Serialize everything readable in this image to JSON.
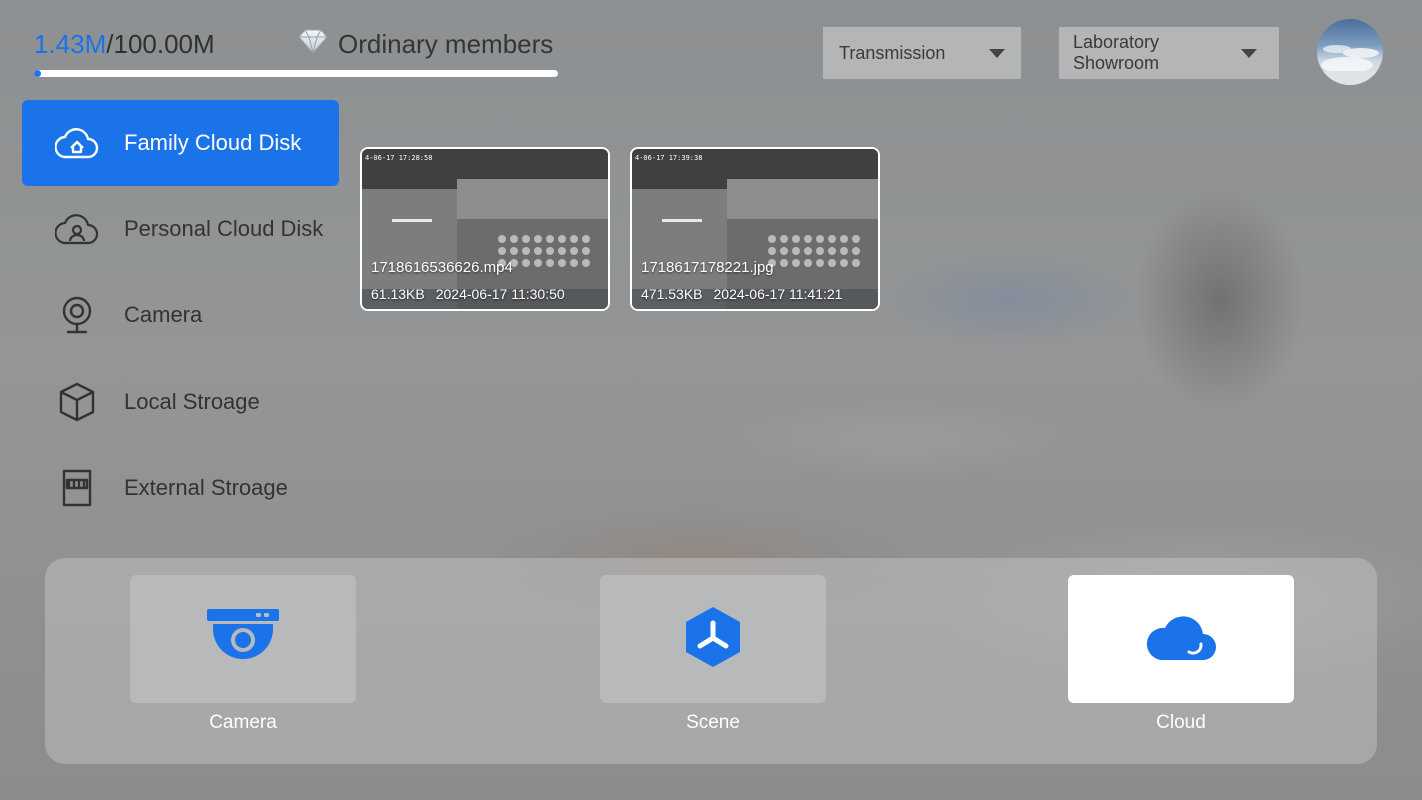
{
  "storage": {
    "used": "1.43M",
    "total": "/100.00M",
    "fraction": 0.0143
  },
  "member": {
    "label": "Ordinary members",
    "icon": "diamond-icon"
  },
  "dropdowns": {
    "transmission": "Transmission",
    "location_line1": "Laboratory",
    "location_line2": "Showroom"
  },
  "sidebar": {
    "items": [
      {
        "label": "Family Cloud Disk",
        "icon": "home-cloud-icon",
        "active": true
      },
      {
        "label": "Personal Cloud Disk",
        "icon": "user-cloud-icon",
        "active": false
      },
      {
        "label": "Camera",
        "icon": "webcam-icon",
        "active": false
      },
      {
        "label": "Local Stroage",
        "icon": "cube-icon",
        "active": false
      },
      {
        "label": "External Stroage",
        "icon": "sd-card-icon",
        "active": false
      }
    ]
  },
  "files": [
    {
      "name": "1718616536626.mp4",
      "size": "61.13KB",
      "date": "2024-06-17 11:30:50",
      "stamp": "4-06-17 17:28:58"
    },
    {
      "name": "1718617178221.jpg",
      "size": "471.53KB",
      "date": "2024-06-17 11:41:21",
      "stamp": "4-06-17 17:39:38"
    }
  ],
  "tabs": [
    {
      "label": "Camera",
      "icon": "dome-camera-icon",
      "active": false
    },
    {
      "label": "Scene",
      "icon": "scene-hexagon-icon",
      "active": false
    },
    {
      "label": "Cloud",
      "icon": "cloud-icon",
      "active": true
    }
  ],
  "colors": {
    "accent": "#1a73e8",
    "active_tile": "#ffffff"
  }
}
